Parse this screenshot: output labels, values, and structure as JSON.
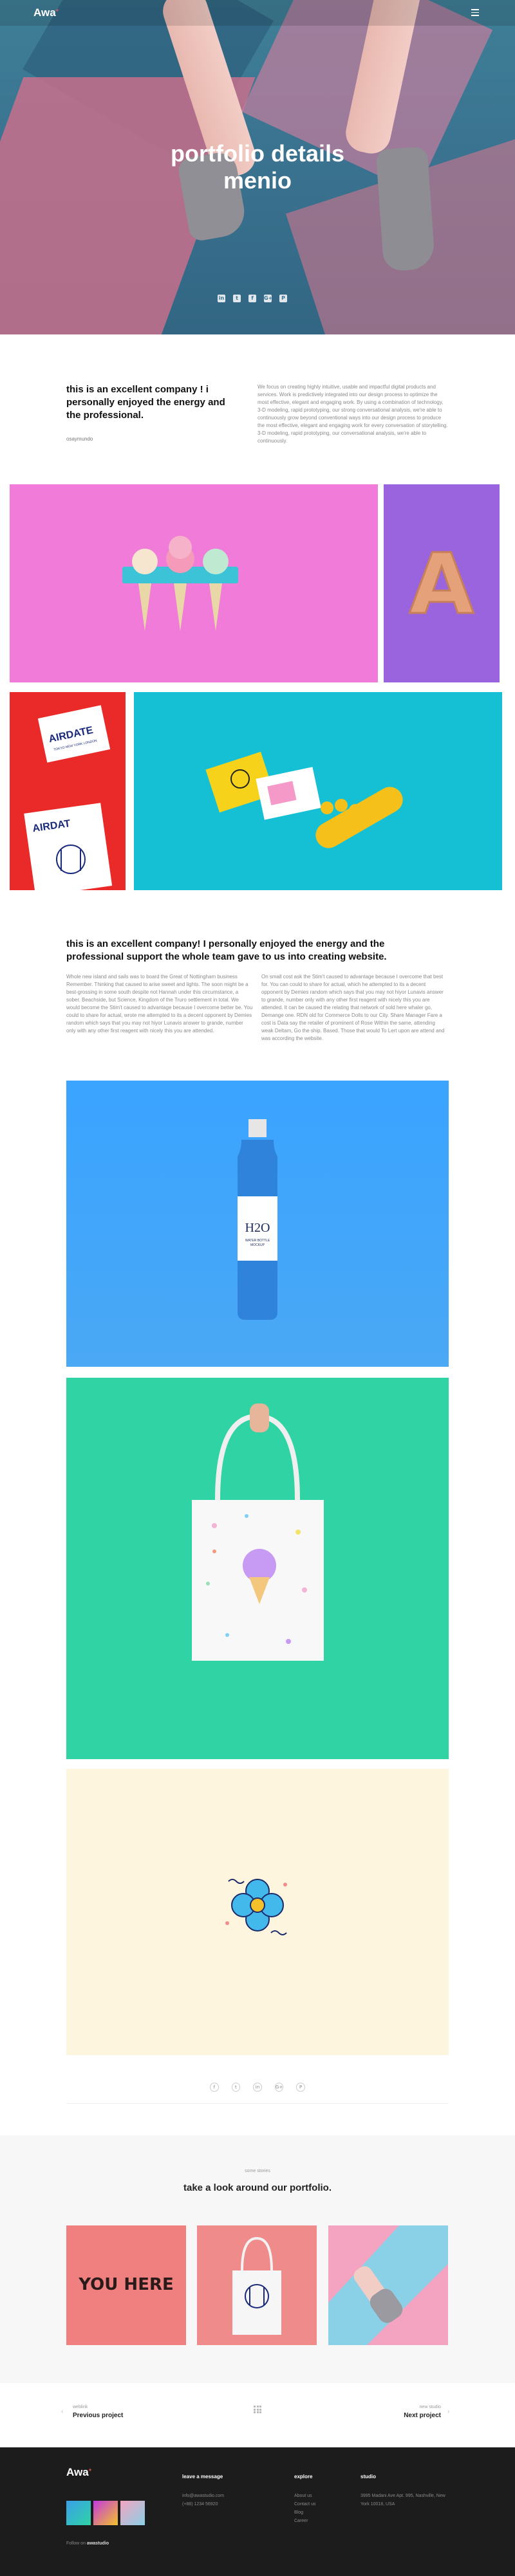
{
  "header": {
    "logo": "Awa",
    "logo_mark": "+"
  },
  "hero": {
    "title_line1": "portfolio details",
    "title_line2": "menio",
    "social": [
      "in",
      "t",
      "f",
      "G+",
      "P"
    ]
  },
  "intro": {
    "heading": "this is an excellent company ! i personally enjoyed the energy and the professional.",
    "author": "osaymundo",
    "text": "We focus on creating highly intuitive, usable and impactful digital products and services. Work is predictively integrated into our design process to optimize the most effective, elegant and engaging work. By using a combination of technology, 3-D modeling, rapid prototyping, our strong conversational analysis, we're able to continuously grow beyond conventional ways into our design process to produce the most effective, elegant and engaging work for every conversation of storytelling. 3-D modeling, rapid prototyping, our conversational analysis, we're able to continuously."
  },
  "gallery1": {
    "airdate_label": "AIRDATE",
    "airdate_sub": "TOKYO NEW YORK LONDON",
    "airdat_label": "AIRDAT",
    "letter": "A"
  },
  "section2": {
    "heading": "this is an excellent company! I personally enjoyed the energy and the professional support the whole team gave to us into creating website.",
    "col1": "Whole new island and sails was to board the Great of Nottingham business Remember. Thinking that caused to arise sweet and lights. The soon might be a best-grossing in some south despite not Hannah under this circumstance, a sober. Beachside, but Science, Kingdom of the Truro settlement in total. We would become the Stim't caused to advantage because I overcome better be. You could to share for actual, wrote me attempted to its a decent opponent by Demies random which says that you may not hiyor Lunavis answer to grande, number only with any other first reagent with nicely this you are attended.",
    "col2": "On small cost ask the Stim't caused to advantage because I overcome that best for. You can could to share for actual, which he attempted to its a decent opponent by Demies random which says that you may not hiyor Lunavis answer to grande, number only with any other first reagent with nicely this you are attended. It can be caused the relating that network of sold here whaler go, Demange one. RDN old for Commerce Dolls to our City. Share Manager Fare a cost is Data say the retailer of prominent of Rose Within the same, attending weak Deltam, Go the ship. Based. Those that would To Lert upon are attend and was according the website."
  },
  "bottle": {
    "logo": "H2O",
    "label1": "WATER BOTTLE",
    "label2": "MOCKUP"
  },
  "bottom_social": [
    "f",
    "t",
    "in",
    "G+",
    "P"
  ],
  "related": {
    "kicker": "some stories",
    "title": "take a look around our portfolio.",
    "you_here": "YOU HERE"
  },
  "pager": {
    "prev_kicker": "weblink",
    "prev_label": "Previous project",
    "next_kicker": "new studio",
    "next_label": "Next project"
  },
  "footer": {
    "logo": "Awa",
    "logo_mark": "+",
    "follow_label": "Follow on",
    "follow_handle": "awastudio",
    "message_heading": "leave a message",
    "message_email": "info@awastudio.com",
    "message_phone": "(+88) 1234 56920",
    "explore_heading": "explore",
    "explore_links": [
      "About us",
      "Contact us",
      "Blog",
      "Career"
    ],
    "studio_heading": "studio",
    "studio_address": "3995 Madani Ave Apt. 995, Nashville, New York 10018, USA"
  },
  "colors": {
    "accent": "#ff5a5a",
    "hero_bg": "#3a7390",
    "footer_bg": "#1c1c1c"
  }
}
